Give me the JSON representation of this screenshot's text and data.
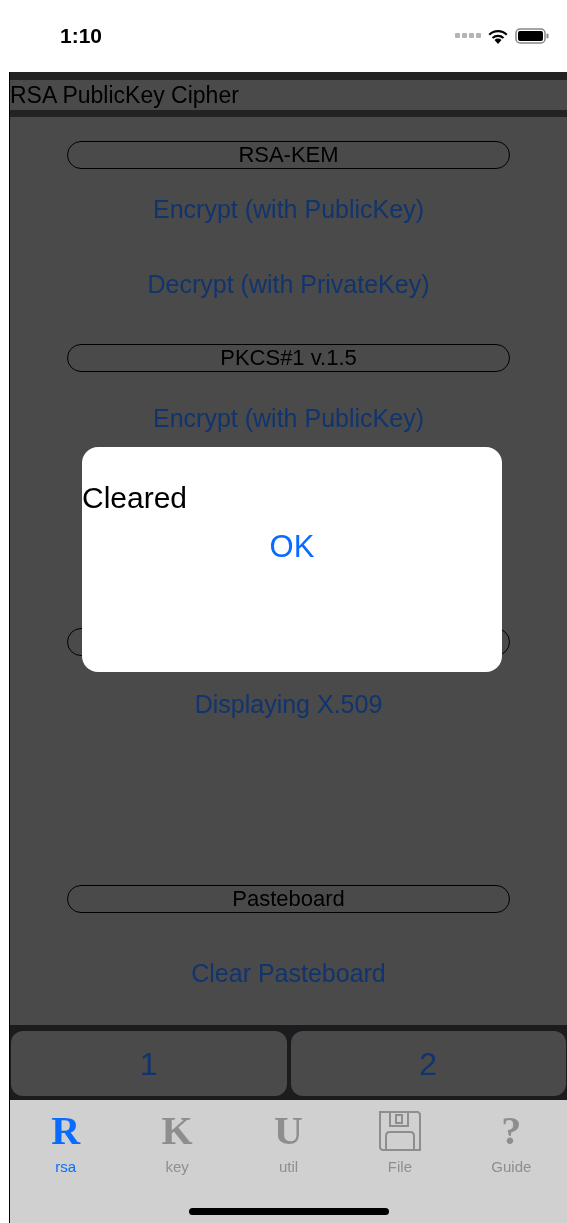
{
  "status_bar": {
    "time": "1:10"
  },
  "title": "RSA PublicKey Cipher",
  "sections": [
    {
      "title": "RSA-KEM",
      "buttons": [
        "Encrypt (with PublicKey)",
        "Decrypt (with PrivateKey)"
      ]
    },
    {
      "title": "PKCS#1 v.1.5",
      "buttons": [
        "Encrypt (with PublicKey)"
      ]
    },
    {
      "buttons": [
        "Displaying X.509"
      ]
    },
    {
      "title": "Pasteboard",
      "buttons": [
        "Clear Pasteboard"
      ]
    }
  ],
  "pages": [
    {
      "label": "1"
    },
    {
      "label": "2"
    }
  ],
  "tabs": [
    {
      "kind": "letter",
      "glyph": "R",
      "label": "rsa",
      "selected": true
    },
    {
      "kind": "letter",
      "glyph": "K",
      "label": "key",
      "selected": false
    },
    {
      "kind": "letter",
      "glyph": "U",
      "label": "util",
      "selected": false
    },
    {
      "kind": "floppy",
      "label": "File",
      "selected": false
    },
    {
      "kind": "letter",
      "glyph": "?",
      "label": "Guide",
      "selected": false
    }
  ],
  "alert": {
    "message": "Cleared",
    "button": "OK"
  }
}
